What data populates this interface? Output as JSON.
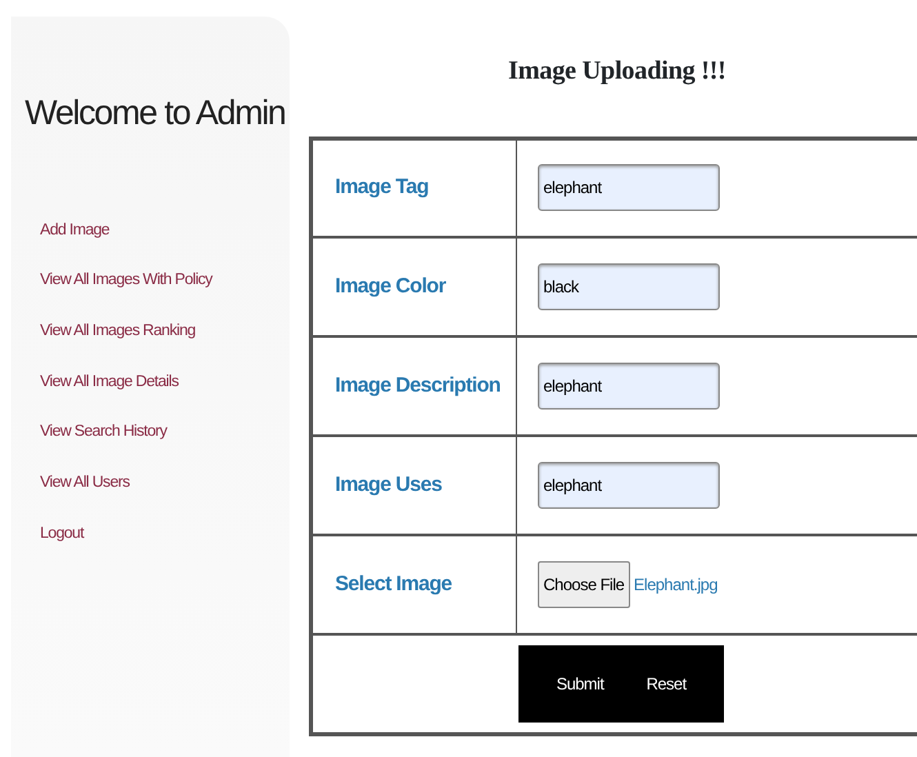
{
  "sidebar": {
    "title": "Welcome to Admin",
    "items": [
      {
        "label": "Add Image"
      },
      {
        "label": "View All Images With Policy"
      },
      {
        "label": "View All Images Ranking"
      },
      {
        "label": "View All Image Details"
      },
      {
        "label": "View Search History"
      },
      {
        "label": "View All Users"
      },
      {
        "label": "Logout"
      }
    ]
  },
  "heading": "Image Uploading !!!",
  "form": {
    "rows": [
      {
        "kind": "text",
        "label": "Image Tag",
        "value": "elephant"
      },
      {
        "kind": "text",
        "label": "Image Color",
        "value": "black"
      },
      {
        "kind": "text",
        "label": "Image Description",
        "value": "elephant"
      },
      {
        "kind": "text",
        "label": "Image Uses",
        "value": "elephant"
      },
      {
        "kind": "file",
        "label": "Select Image",
        "button": "Choose File",
        "file_name": "Elephant.jpg"
      }
    ],
    "buttons": [
      "Submit",
      "Reset"
    ]
  }
}
